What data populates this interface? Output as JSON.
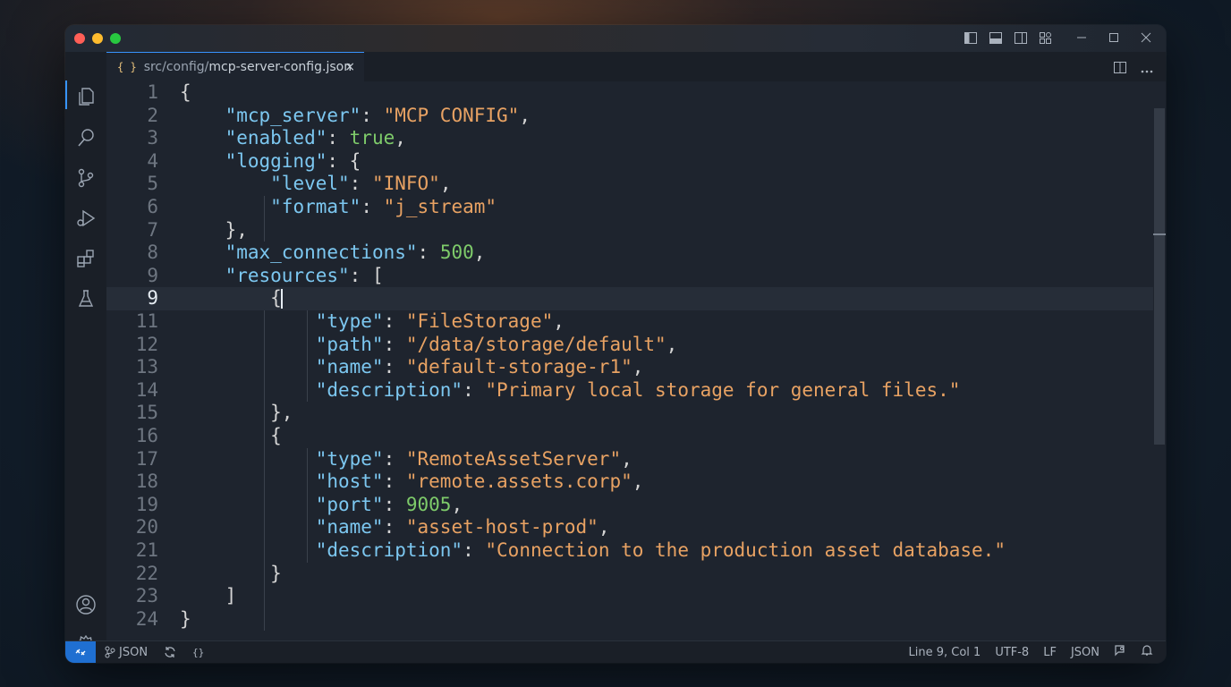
{
  "tab": {
    "icon": "json-braces-icon",
    "icon_glyph": "{ }",
    "path_prefix": "src/config/",
    "filename": "mcp-server-config.json",
    "close_glyph": "×"
  },
  "activity_bar": [
    "explorer-icon",
    "search-icon",
    "source-control-icon",
    "run-debug-icon",
    "extensions-icon",
    "testing-icon",
    "account-icon",
    "settings-gear-icon"
  ],
  "editor": {
    "current_line_number": "9",
    "lines": [
      {
        "n": "1"
      },
      {
        "n": "2"
      },
      {
        "n": "3"
      },
      {
        "n": "4"
      },
      {
        "n": "5"
      },
      {
        "n": "6"
      },
      {
        "n": "7"
      },
      {
        "n": "8"
      },
      {
        "n": "9"
      },
      {
        "n": "9"
      },
      {
        "n": "11"
      },
      {
        "n": "12"
      },
      {
        "n": "13"
      },
      {
        "n": "14"
      },
      {
        "n": "15"
      },
      {
        "n": "16"
      },
      {
        "n": "17"
      },
      {
        "n": "18"
      },
      {
        "n": "19"
      },
      {
        "n": "20"
      },
      {
        "n": "21"
      },
      {
        "n": "22"
      },
      {
        "n": "23"
      },
      {
        "n": "24"
      }
    ],
    "tokens": {
      "k_mcp_server": "\"mcp_server\"",
      "v_mcp_server": "\"MCP CONFIG\"",
      "k_enabled": "\"enabled\"",
      "v_enabled": "true",
      "k_logging": "\"logging\"",
      "k_level": "\"level\"",
      "v_level": "\"INFO\"",
      "k_format": "\"format\"",
      "v_format": "\"j_stream\"",
      "k_max_connections": "\"max_connections\"",
      "v_max_connections": "500",
      "k_resources": "\"resources\"",
      "k_type1": "\"type\"",
      "v_type1": "\"FileStorage\"",
      "k_path": "\"path\"",
      "v_path": "\"/data/storage/default\"",
      "k_name1": "\"name\"",
      "v_name1": "\"default-storage-r1\"",
      "k_desc1": "\"description\"",
      "v_desc1": "\"Primary local storage for general files.\"",
      "k_type2": "\"type\"",
      "v_type2": "\"RemoteAssetServer\"",
      "k_host": "\"host\"",
      "v_host": "\"remote.assets.corp\"",
      "k_port": "\"port\"",
      "v_port": "9005",
      "k_name2": "\"name\"",
      "v_name2": "\"asset-host-prod\"",
      "k_desc2": "\"description\"",
      "v_desc2": "\"Connection to the production asset database.\""
    }
  },
  "status_bar": {
    "remote_icon": "remote-icon",
    "branch_icon": "git-branch-icon",
    "language_left": "JSON",
    "sync_icon": "sync-icon",
    "braces_icon": "braces-icon",
    "braces_glyph": "{}",
    "cursor_position": "Line 9, Col 1",
    "encoding": "UTF-8",
    "eol": "LF",
    "language_right": "JSON",
    "feedback_icon": "feedback-icon",
    "bell_icon": "notifications-bell-icon"
  },
  "colors": {
    "key": "#7cc7f0",
    "string": "#e8a263",
    "number": "#7ecb6a",
    "accent": "#3794ff",
    "remote_bg": "#1f6fd1"
  }
}
